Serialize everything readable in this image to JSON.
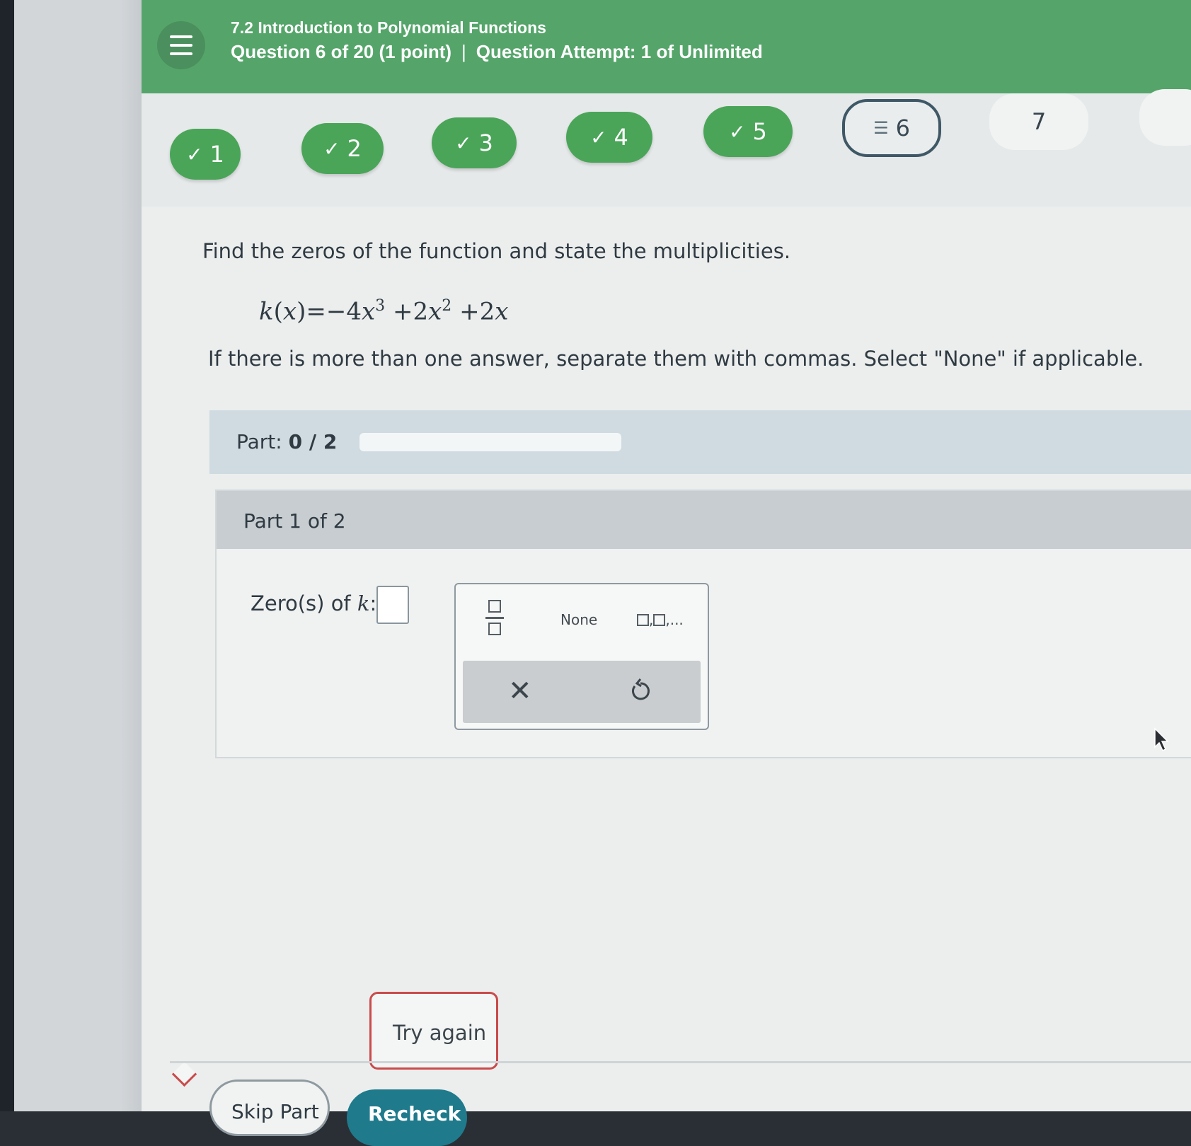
{
  "header": {
    "title": "7.2 Introduction to Polynomial Functions",
    "question_info": "Question 6 of 20 (1 point)",
    "separator": "|",
    "attempt_info": "Question Attempt: 1 of Unlimited",
    "accent_color": "#55a56a"
  },
  "question_nav": {
    "check_glyph": "✓",
    "current_glyph": "☰",
    "items": [
      {
        "label": "1",
        "state": "done"
      },
      {
        "label": "2",
        "state": "done"
      },
      {
        "label": "3",
        "state": "done"
      },
      {
        "label": "4",
        "state": "done"
      },
      {
        "label": "5",
        "state": "done"
      },
      {
        "label": "6",
        "state": "current"
      },
      {
        "label": "7",
        "state": "upcoming"
      }
    ]
  },
  "question": {
    "prompt": "Find the zeros of the function and state the multiplicities.",
    "equation": {
      "lhs": "k",
      "arg": "x",
      "eq": "=",
      "coef1": "−4",
      "exp1": "3",
      "coef2": "+2",
      "exp2": "2",
      "term3": "+2"
    },
    "instructions": "If there is more than one answer, separate them with commas. Select \"None\" if applicable."
  },
  "part_progress": {
    "label": "Part:",
    "value": "0 / 2",
    "fraction": 0
  },
  "part": {
    "heading": "Part 1 of 2",
    "answer_label": "Zero(s) of",
    "answer_var": "k",
    "answer_colon": ":",
    "answer_value": ""
  },
  "keypad": {
    "fraction_icon": "fraction-icon",
    "none_label": "None",
    "list_suffix": ",...",
    "clear_glyph": "✕",
    "undo_icon": "undo-icon"
  },
  "feedback": {
    "text": "Try again",
    "color": "#c94b4b"
  },
  "footer": {
    "skip_label": "Skip Part",
    "recheck_label": "Recheck"
  }
}
